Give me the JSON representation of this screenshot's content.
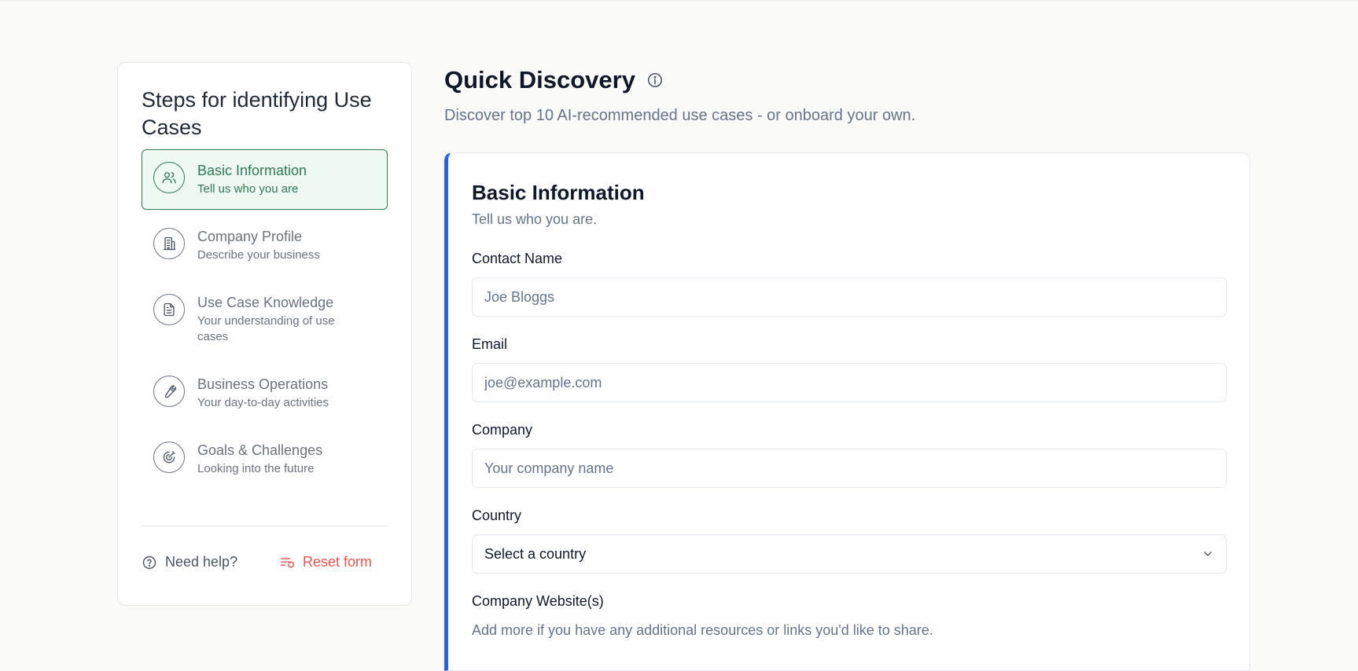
{
  "sidebar": {
    "title": "Steps for identifying Use Cases",
    "steps": [
      {
        "label": "Basic Information",
        "sub": "Tell us who you are",
        "icon": "users-icon",
        "active": true
      },
      {
        "label": "Company Profile",
        "sub": "Describe your business",
        "icon": "building-icon",
        "active": false
      },
      {
        "label": "Use Case Knowledge",
        "sub": "Your understanding of use cases",
        "icon": "document-icon",
        "active": false
      },
      {
        "label": "Business Operations",
        "sub": "Your day-to-day activities",
        "icon": "wrench-icon",
        "active": false
      },
      {
        "label": "Goals & Challenges",
        "sub": "Looking into the future",
        "icon": "target-icon",
        "active": false
      }
    ],
    "help_label": "Need help?",
    "reset_label": "Reset form"
  },
  "main": {
    "title": "Quick Discovery",
    "subtitle": "Discover top 10 AI-recommended use cases - or onboard your own."
  },
  "form": {
    "title": "Basic Information",
    "subtitle": "Tell us who you are.",
    "contact_name": {
      "label": "Contact Name",
      "placeholder": "Joe Bloggs",
      "value": ""
    },
    "email": {
      "label": "Email",
      "placeholder": "joe@example.com",
      "value": ""
    },
    "company": {
      "label": "Company",
      "placeholder": "Your company name",
      "value": ""
    },
    "country": {
      "label": "Country",
      "selected": "Select a country"
    },
    "website": {
      "label": "Company Website(s)",
      "help": "Add more if you have any additional resources or links you'd like to share."
    }
  },
  "colors": {
    "accent_green": "#2f7a55",
    "active_step_bg": "#edf9f1",
    "accent_blue": "#2563eb",
    "reset_red": "#ef5350"
  }
}
